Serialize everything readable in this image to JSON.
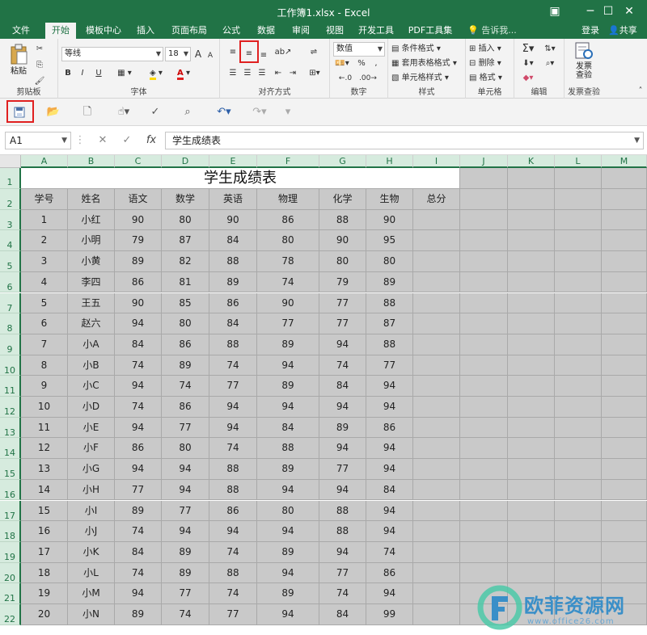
{
  "window": {
    "title": "工作簿1.xlsx - Excel"
  },
  "ribbon_tabs": [
    "文件",
    "开始",
    "模板中心",
    "插入",
    "页面布局",
    "公式",
    "数据",
    "审阅",
    "视图",
    "开发工具",
    "PDF工具集"
  ],
  "tell_me": "告诉我...",
  "account": {
    "login": "登录",
    "share": "共享"
  },
  "clipboard": {
    "paste": "粘贴",
    "label": "剪贴板"
  },
  "font": {
    "name": "等线",
    "size": "18",
    "bold": "B",
    "italic": "I",
    "underline": "U",
    "label": "字体",
    "grow": "A",
    "shrink": "A"
  },
  "alignment": {
    "label": "对齐方式"
  },
  "number": {
    "format": "数值",
    "percent": "%",
    "comma": ",",
    "label": "数字"
  },
  "styles": {
    "conditional": "条件格式",
    "table": "套用表格格式",
    "cell": "单元格样式",
    "label": "样式"
  },
  "cells": {
    "insert": "插入",
    "delete": "删除",
    "format": "格式",
    "label": "单元格"
  },
  "editing": {
    "label": "编辑"
  },
  "invoice": {
    "line1": "发票",
    "line2": "查验",
    "label": "发票查验"
  },
  "name_box": "A1",
  "formula": "学生成绩表",
  "columns": [
    "A",
    "B",
    "C",
    "D",
    "E",
    "F",
    "G",
    "H",
    "I",
    "J",
    "K",
    "L",
    "M"
  ],
  "sheet_title": "学生成绩表",
  "headers": [
    "学号",
    "姓名",
    "语文",
    "数学",
    "英语",
    "物理",
    "化学",
    "生物",
    "总分"
  ],
  "rows": [
    [
      "1",
      "小红",
      "90",
      "80",
      "90",
      "86",
      "88",
      "90"
    ],
    [
      "2",
      "小明",
      "79",
      "87",
      "84",
      "80",
      "90",
      "95"
    ],
    [
      "3",
      "小黄",
      "89",
      "82",
      "88",
      "78",
      "80",
      "80"
    ],
    [
      "4",
      "李四",
      "86",
      "81",
      "89",
      "74",
      "79",
      "89"
    ],
    [
      "5",
      "王五",
      "90",
      "85",
      "86",
      "90",
      "77",
      "88"
    ],
    [
      "6",
      "赵六",
      "94",
      "80",
      "84",
      "77",
      "77",
      "87"
    ],
    [
      "7",
      "小A",
      "84",
      "86",
      "88",
      "89",
      "94",
      "88"
    ],
    [
      "8",
      "小B",
      "74",
      "89",
      "74",
      "94",
      "74",
      "77"
    ],
    [
      "9",
      "小C",
      "94",
      "74",
      "77",
      "89",
      "84",
      "94"
    ],
    [
      "10",
      "小D",
      "74",
      "86",
      "94",
      "94",
      "94",
      "94"
    ],
    [
      "11",
      "小E",
      "94",
      "77",
      "94",
      "84",
      "89",
      "86"
    ],
    [
      "12",
      "小F",
      "86",
      "80",
      "74",
      "88",
      "94",
      "94"
    ],
    [
      "13",
      "小G",
      "94",
      "94",
      "88",
      "89",
      "77",
      "94"
    ],
    [
      "14",
      "小H",
      "77",
      "94",
      "88",
      "94",
      "94",
      "84"
    ],
    [
      "15",
      "小I",
      "89",
      "77",
      "86",
      "80",
      "88",
      "94"
    ],
    [
      "16",
      "小J",
      "74",
      "94",
      "94",
      "94",
      "88",
      "94"
    ],
    [
      "17",
      "小K",
      "84",
      "89",
      "74",
      "89",
      "94",
      "74"
    ],
    [
      "18",
      "小L",
      "74",
      "89",
      "88",
      "94",
      "77",
      "86"
    ],
    [
      "19",
      "小M",
      "94",
      "77",
      "74",
      "89",
      "74",
      "94"
    ],
    [
      "20",
      "小N",
      "89",
      "74",
      "77",
      "94",
      "84",
      "99"
    ]
  ],
  "row_numbers": [
    "1",
    "2",
    "3",
    "4",
    "5",
    "6",
    "7",
    "8",
    "9",
    "10",
    "11",
    "12",
    "13",
    "14",
    "15",
    "16",
    "17",
    "18",
    "19",
    "20",
    "21",
    "22"
  ],
  "watermark": {
    "text": "欧菲资源网",
    "url": "www.office26.com"
  },
  "colors": {
    "excel_green": "#217346",
    "highlight_red": "#e02020",
    "cell_gray": "#c9c9c9"
  }
}
